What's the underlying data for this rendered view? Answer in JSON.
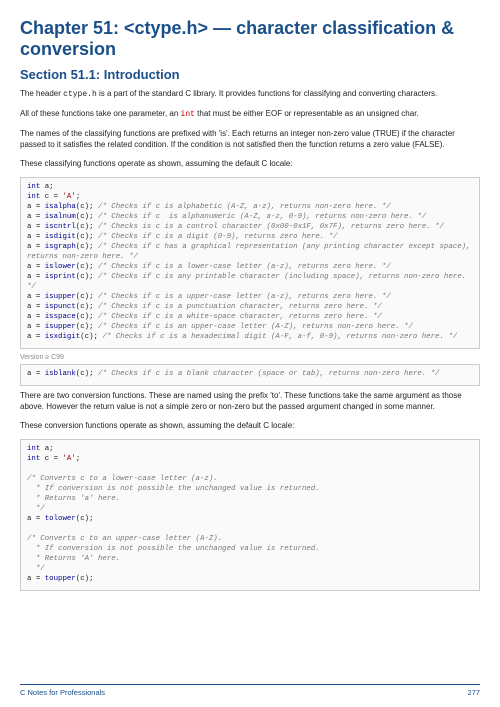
{
  "chapter_title": "Chapter 51: <ctype.h> — character classification & conversion",
  "section_title": "Section 51.1: Introduction",
  "p1a": "The header ",
  "p1code": "ctype.h",
  "p1b": " is a part of the standard C library. It provides functions for classifying and converting characters.",
  "p2a": "All of these functions take one parameter, an ",
  "p2code": "int",
  "p2b": " that must be either EOF or representable as an unsigned char.",
  "p3": "The names of the classifying functions are prefixed with 'is'. Each returns an integer non-zero value (TRUE) if the character passed to it satisfies the related condition. If the condition is not satisfied then the function returns a zero value (FALSE).",
  "p4": "These classifying functions operate as shown, assuming the default C locale:",
  "p5": "There are two conversion functions. These are named using the prefix 'to'. These functions take the same argument as those above. However the return value is not a simple zero or non-zero but the passed argument changed in some manner.",
  "p6": "These conversion functions operate as shown, assuming the default C locale:",
  "footer_left": "C Notes for Professionals",
  "footer_right": "277",
  "code1": {
    "kw_int": "int",
    "var_a": "a",
    "var_c": "c",
    "ch": "'A'",
    "f1": "isalpha",
    "c1": "/* Checks if c is alphabetic (A-Z, a-z), returns non-zero here. */",
    "f2": "isalnum",
    "c2": "/* Checks if c  is alphanumeric (A-Z, a-z, 0-9), returns non-zero here. */",
    "f3": "iscntrl",
    "c3": "/* Checks is c is a control character (0x00-0x1F, 0x7F), returns zero here. */",
    "f4": "isdigit",
    "c4": "/* Checks if c is a digit (0-9), returns zero here. */",
    "f5": "isgraph",
    "c5": "/* Checks if c has a graphical representation (any printing character except space), returns non-zero here. */",
    "f6": "islower",
    "c6": "/* Checks if c is a lower-case letter (a-z), returns zero here. */",
    "f7": "isprint",
    "c7": "/* Checks if c is any printable character (including space), returns non-zero here. */",
    "f8": "isupper",
    "c8": "/* Checks if c is a upper-case letter (a-z), returns zero here. */",
    "f9": "ispunct",
    "c9": "/* Checks if c is a punctuation character, returns zero here. */",
    "f10": "isspace",
    "c10": "/* Checks if c is a white-space character, returns zero here. */",
    "f11": "isupper",
    "c11": "/* Checks if c is an upper-case letter (A-Z), returns non-zero here. */",
    "f12": "isxdigit",
    "c12": "/* Checks if c is a hexadecimal digit (A-F, a-f, 0-9), returns non-zero here. */",
    "ver": "Version ≥ C99",
    "f13": "isblank",
    "c13": "/* Checks if c is a blank character (space or tab), returns non-zero here. */"
  },
  "code2": {
    "kw_int": "int",
    "var_a": "a",
    "var_c": "c",
    "ch": "'A'",
    "c1": "/* Converts c to a lower-case letter (a-z).\n  * If conversion is not possible the unchanged value is returned.\n  * Returns 'a' here.\n  */",
    "f1": "tolower",
    "c2": "/* Converts c to an upper-case letter (A-Z).\n  * If conversion is not possible the unchanged value is returned.\n  * Returns 'A' here.\n  */",
    "f2": "toupper"
  }
}
